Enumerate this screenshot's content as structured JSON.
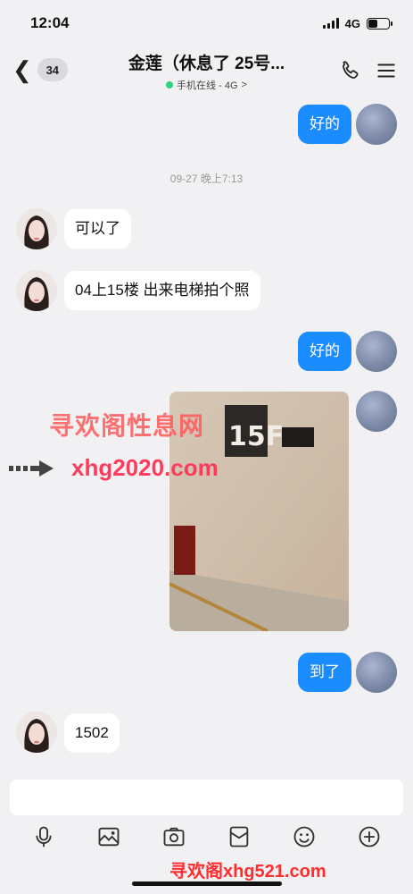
{
  "status_bar": {
    "time": "12:04",
    "network": "4G"
  },
  "header": {
    "back_badge": "34",
    "title": "金莲（休息了 25号...",
    "status": "手机在线 - 4G",
    "status_chevron": ">"
  },
  "messages": [
    {
      "side": "out",
      "type": "text",
      "text": "好的"
    },
    {
      "type": "time",
      "text": "09-27 晚上7:13"
    },
    {
      "side": "in",
      "type": "text",
      "text": "可以了"
    },
    {
      "side": "in",
      "type": "text",
      "text": "04上15楼 出来电梯拍个照"
    },
    {
      "side": "out",
      "type": "text",
      "text": "好的"
    },
    {
      "side": "out",
      "type": "image",
      "floor_label": "15F"
    },
    {
      "side": "out",
      "type": "text",
      "text": "到了"
    },
    {
      "side": "in",
      "type": "text",
      "text": "1502"
    }
  ],
  "watermarks": {
    "site_cn": "寻欢阁性息网",
    "site_url": "xhg2020.com",
    "bottom": "寻欢阁xhg521.com"
  },
  "toolbar": [
    "mic-icon",
    "image-icon",
    "camera-icon",
    "red-packet-icon",
    "emoji-icon",
    "plus-icon"
  ],
  "colors": {
    "accent": "#1a8cff",
    "online": "#2cd57b",
    "watermark": "#ff3b5c"
  }
}
